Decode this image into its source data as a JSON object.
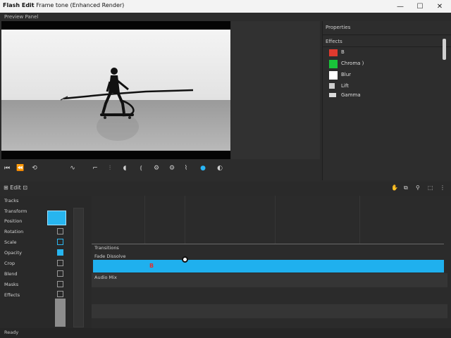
{
  "window": {
    "title": "Flash Edit",
    "subtitle": "Frame tone (Enhanced Render)",
    "buttons": {
      "minimize": "—",
      "maximize": "☐",
      "close": "✕"
    }
  },
  "preview": {
    "header": "Preview Panel"
  },
  "controls": {
    "items": [
      {
        "name": "rewind-icon",
        "glyph": "⏮"
      },
      {
        "name": "step-back-icon",
        "glyph": "⏪"
      },
      {
        "name": "loop-icon",
        "glyph": "⟲"
      },
      {
        "name": "audio-wave-icon",
        "glyph": "∿"
      },
      {
        "name": "crop-icon",
        "glyph": "⌐"
      },
      {
        "name": "split-icon",
        "glyph": "⫶"
      },
      {
        "name": "speaker-icon",
        "glyph": "◖"
      },
      {
        "name": "bracket-in-icon",
        "glyph": "⦅"
      },
      {
        "name": "settings-icon",
        "glyph": "⚙"
      },
      {
        "name": "marker-icon",
        "glyph": "⌇"
      },
      {
        "name": "record-icon",
        "glyph": "●"
      },
      {
        "name": "toggle-icon",
        "glyph": "◐"
      }
    ]
  },
  "properties": {
    "header": "Properties",
    "section": "Effects",
    "rows": [
      {
        "label": "B",
        "color": "#e03a2e"
      },
      {
        "label": "Chroma )",
        "color": "#19c43a"
      },
      {
        "label": "Blur",
        "color": "#ffffff"
      },
      {
        "label": "Lift",
        "color": "#cfcfcf"
      },
      {
        "label": "Gamma",
        "color": "#dcdcdc"
      }
    ]
  },
  "timeline": {
    "toolbar_left": "⊞ Edit ⊡",
    "toolbar_right": [
      "✋",
      "⧉",
      "⚲",
      "⬚",
      "⋮"
    ],
    "track_header": "Tracks",
    "tracks": [
      "Transform",
      "Position",
      "Rotation",
      "Scale",
      "Opacity",
      "Crop",
      "Blend",
      "Masks",
      "Effects"
    ],
    "lanes": {
      "label1": "Transitions",
      "label2": "Fade Dissolve",
      "label3": "Audio Mix"
    },
    "clip_label": "B",
    "status": "Ready"
  }
}
